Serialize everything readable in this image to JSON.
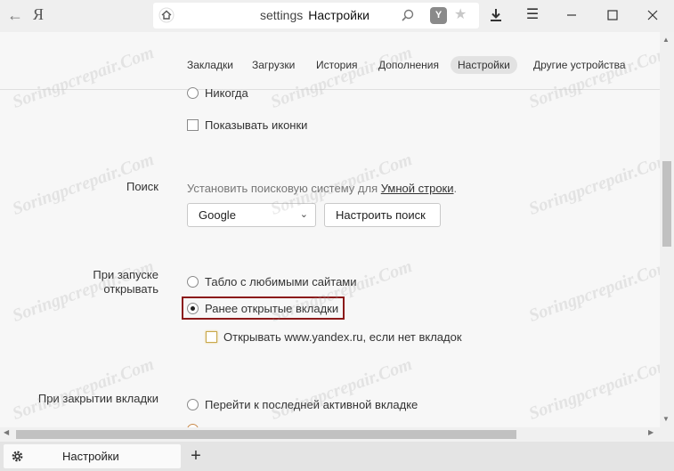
{
  "browser": {
    "logo": "Я",
    "address_host": "settings",
    "address_page": "Настройки",
    "protect_badge": "Y"
  },
  "nav": {
    "items": [
      "Закладки",
      "Загрузки",
      "История",
      "Дополнения",
      "Настройки",
      "Другие устройства"
    ],
    "active": "Настройки"
  },
  "settings": {
    "top_radio_label": "Никогда",
    "show_icons_label": "Показывать иконки",
    "search": {
      "section_label": "Поиск",
      "hint_prefix": "Установить поисковую систему для ",
      "hint_link": "Умной строки",
      "hint_suffix": ".",
      "engine_value": "Google",
      "configure_button": "Настроить поиск"
    },
    "startup": {
      "section_label_line1": "При запуске",
      "section_label_line2": "открывать",
      "option_tableau": "Табло с любимыми сайтами",
      "option_previous_tabs": "Ранее открытые вкладки",
      "open_yandex_if_no_tabs": "Открывать www.yandex.ru, если нет вкладок",
      "selected": "option_previous_tabs"
    },
    "tab_close": {
      "section_label": "При закрытии вкладки",
      "option_last_active": "Перейти к последней активной вкладке"
    }
  },
  "tabstrip": {
    "tab_title": "Настройки",
    "new_tab_symbol": "+"
  },
  "watermark_text": "Soringpcrepair.Com",
  "colors": {
    "highlight_border": "#8b1a1a",
    "page_bg": "#f7f7f7",
    "chrome_bg": "#efefef"
  }
}
